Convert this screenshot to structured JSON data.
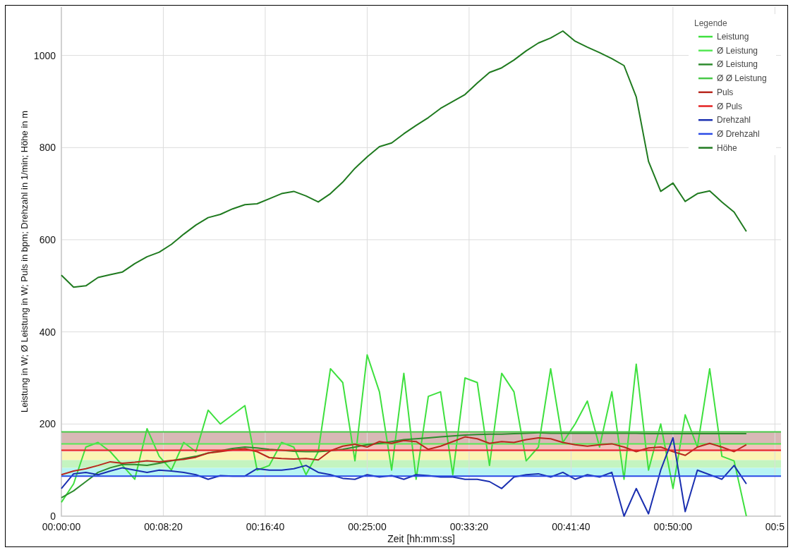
{
  "chart": {
    "legend_title": "Legende",
    "chart_data": {
      "type": "line",
      "xlabel": "Zeit [hh:mm:ss]",
      "ylabel": "Leistung in W; Ø Leistung in W; Puls in bpm; Drehzahl in 1/min; Höhe in m",
      "x": [
        0,
        60,
        120,
        180,
        240,
        300,
        360,
        420,
        480,
        540,
        600,
        660,
        720,
        780,
        840,
        900,
        960,
        1020,
        1080,
        1140,
        1200,
        1260,
        1320,
        1380,
        1440,
        1500,
        1560,
        1620,
        1680,
        1740,
        1800,
        1860,
        1920,
        1980,
        2040,
        2100,
        2160,
        2220,
        2280,
        2340,
        2400,
        2460,
        2520,
        2580,
        2640,
        2700,
        2760,
        2820,
        2880,
        2940,
        3000,
        3060,
        3120,
        3180,
        3240,
        3300,
        3360,
        3530
      ],
      "series": [
        {
          "name": "Leistung",
          "color": "#3ee03e",
          "values": [
            30,
            70,
            150,
            160,
            140,
            110,
            80,
            190,
            130,
            100,
            160,
            140,
            230,
            200,
            220,
            240,
            100,
            110,
            160,
            150,
            90,
            140,
            320,
            290,
            120,
            350,
            270,
            100,
            310,
            80,
            260,
            270,
            90,
            300,
            290,
            110,
            310,
            270,
            120,
            150,
            320,
            160,
            200,
            250,
            150,
            270,
            80,
            330,
            100,
            200,
            60,
            220,
            150,
            320,
            130,
            120,
            0,
            null
          ]
        },
        {
          "name": "Ø Leistung",
          "color": "#55e855",
          "values": [
            157,
            157,
            157,
            157,
            157,
            157,
            157,
            157,
            157,
            157,
            157,
            157,
            157,
            157,
            157,
            157,
            157,
            157,
            157,
            157,
            157,
            157,
            157,
            157,
            157,
            157,
            157,
            157,
            157,
            157,
            157,
            157,
            157,
            157,
            157,
            157,
            157,
            157,
            157,
            157,
            157,
            157,
            157,
            157,
            157,
            157,
            157,
            157,
            157,
            157,
            157,
            157,
            157,
            157,
            157,
            157,
            157,
            157
          ]
        },
        {
          "name": "Ø Leistung",
          "color": "#2e8b2e",
          "values": [
            40,
            55,
            75,
            95,
            105,
            112,
            112,
            110,
            115,
            120,
            125,
            130,
            137,
            142,
            147,
            150,
            148,
            145,
            143,
            141,
            140,
            140,
            142,
            145,
            150,
            155,
            158,
            162,
            166,
            168,
            170,
            172,
            174,
            176,
            177,
            178,
            178,
            179,
            180,
            181,
            180,
            180,
            180,
            180,
            180,
            180,
            180,
            180,
            179,
            179,
            179,
            179,
            179,
            179,
            179,
            179,
            179,
            null
          ]
        },
        {
          "name": "Ø Ø Leistung",
          "color": "#48c848",
          "values": [
            183,
            183,
            183,
            183,
            183,
            183,
            183,
            183,
            183,
            183,
            183,
            183,
            183,
            183,
            183,
            183,
            183,
            183,
            183,
            183,
            183,
            183,
            183,
            183,
            183,
            183,
            183,
            183,
            183,
            183,
            183,
            183,
            183,
            183,
            183,
            183,
            183,
            183,
            183,
            183,
            183,
            183,
            183,
            183,
            183,
            183,
            183,
            183,
            183,
            183,
            183,
            183,
            183,
            183,
            183,
            183,
            183,
            183
          ]
        },
        {
          "name": "Puls",
          "color": "#b8281e",
          "values": [
            90,
            98,
            103,
            110,
            118,
            115,
            117,
            120,
            118,
            121,
            123,
            128,
            137,
            140,
            144,
            146,
            140,
            127,
            125,
            124,
            125,
            122,
            142,
            152,
            156,
            150,
            162,
            158,
            164,
            162,
            145,
            152,
            162,
            172,
            168,
            158,
            162,
            160,
            166,
            170,
            168,
            160,
            155,
            152,
            155,
            157,
            150,
            140,
            148,
            150,
            140,
            132,
            150,
            158,
            150,
            140,
            155,
            null
          ]
        },
        {
          "name": "Ø Puls",
          "color": "#e52222",
          "values": [
            143,
            143,
            143,
            143,
            143,
            143,
            143,
            143,
            143,
            143,
            143,
            143,
            143,
            143,
            143,
            143,
            143,
            143,
            143,
            143,
            143,
            143,
            143,
            143,
            143,
            143,
            143,
            143,
            143,
            143,
            143,
            143,
            143,
            143,
            143,
            143,
            143,
            143,
            143,
            143,
            143,
            143,
            143,
            143,
            143,
            143,
            143,
            143,
            143,
            143,
            143,
            143,
            143,
            143,
            143,
            143,
            143,
            143
          ]
        },
        {
          "name": "Drehzahl",
          "color": "#1a2fb0",
          "values": [
            60,
            92,
            95,
            90,
            98,
            105,
            100,
            95,
            100,
            98,
            95,
            90,
            80,
            88,
            87,
            87,
            103,
            100,
            100,
            103,
            110,
            95,
            90,
            82,
            80,
            90,
            85,
            88,
            80,
            90,
            88,
            85,
            85,
            80,
            80,
            75,
            60,
            85,
            90,
            92,
            85,
            95,
            80,
            90,
            85,
            95,
            0,
            60,
            5,
            100,
            170,
            10,
            100,
            90,
            80,
            110,
            70,
            null
          ]
        },
        {
          "name": "Ø Drehzahl",
          "color": "#2a4ae6",
          "values": [
            87,
            87,
            87,
            87,
            87,
            87,
            87,
            87,
            87,
            87,
            87,
            87,
            87,
            87,
            87,
            87,
            87,
            87,
            87,
            87,
            87,
            87,
            87,
            87,
            87,
            87,
            87,
            87,
            87,
            87,
            87,
            87,
            87,
            87,
            87,
            87,
            87,
            87,
            87,
            87,
            87,
            87,
            87,
            87,
            87,
            87,
            87,
            87,
            87,
            87,
            87,
            87,
            87,
            87,
            87,
            87,
            87,
            87
          ]
        },
        {
          "name": "Höhe",
          "color": "#1f7a1f",
          "values": [
            523,
            497,
            500,
            518,
            524,
            530,
            548,
            563,
            573,
            590,
            612,
            632,
            648,
            655,
            667,
            676,
            678,
            689,
            700,
            705,
            695,
            682,
            700,
            725,
            755,
            780,
            802,
            810,
            830,
            848,
            865,
            885,
            900,
            915,
            940,
            963,
            973,
            990,
            1010,
            1027,
            1038,
            1053,
            1031,
            1018,
            1006,
            993,
            978,
            910,
            770,
            705,
            723,
            683,
            700,
            706,
            682,
            660,
            618,
            null
          ]
        }
      ],
      "xlim": [
        0,
        3530
      ],
      "ylim": [
        0,
        1105
      ],
      "xticks": [
        {
          "value": 0,
          "label": "00:00:00"
        },
        {
          "value": 500,
          "label": "00:08:20"
        },
        {
          "value": 1000,
          "label": "00:16:40"
        },
        {
          "value": 1500,
          "label": "00:25:00"
        },
        {
          "value": 2000,
          "label": "00:33:20"
        },
        {
          "value": 2500,
          "label": "00:41:40"
        },
        {
          "value": 3000,
          "label": "00:50:00"
        },
        {
          "value": 3500,
          "label": "00:5"
        }
      ],
      "yticks": [
        0,
        200,
        400,
        600,
        800,
        1000
      ],
      "grid": true,
      "legend": true,
      "bands": [
        {
          "axis": "y",
          "from": 87,
          "to": 105,
          "color": "#b8f4f4"
        },
        {
          "axis": "y",
          "from": 105,
          "to": 122,
          "color": "#c4f4c0"
        },
        {
          "axis": "y",
          "from": 122,
          "to": 140,
          "color": "#fbf4b4"
        },
        {
          "axis": "y",
          "from": 140,
          "to": 157,
          "color": "#f4c0bc"
        },
        {
          "axis": "y",
          "from": 157,
          "to": 183,
          "color": "#d8b8b6"
        }
      ]
    }
  }
}
